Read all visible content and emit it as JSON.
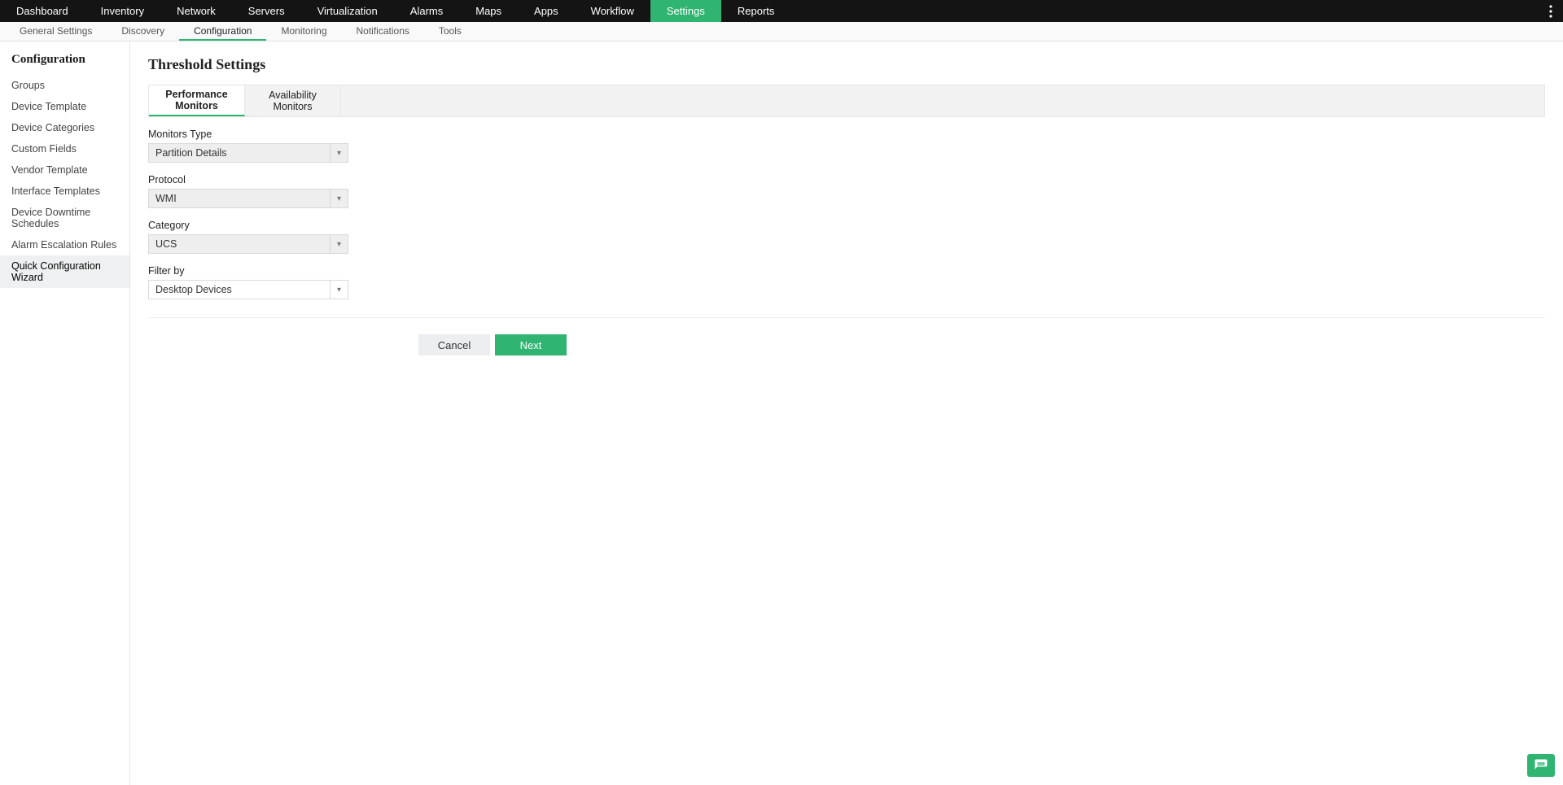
{
  "topnav": {
    "items": [
      "Dashboard",
      "Inventory",
      "Network",
      "Servers",
      "Virtualization",
      "Alarms",
      "Maps",
      "Apps",
      "Workflow",
      "Settings",
      "Reports"
    ],
    "active_index": 9
  },
  "subnav": {
    "items": [
      "General Settings",
      "Discovery",
      "Configuration",
      "Monitoring",
      "Notifications",
      "Tools"
    ],
    "active_index": 2
  },
  "sidebar": {
    "title": "Configuration",
    "items": [
      "Groups",
      "Device Template",
      "Device Categories",
      "Custom Fields",
      "Vendor Template",
      "Interface Templates",
      "Device Downtime Schedules",
      "Alarm Escalation Rules",
      "Quick Configuration Wizard"
    ],
    "active_index": 8
  },
  "page": {
    "title": "Threshold Settings"
  },
  "tabs": {
    "items": [
      {
        "line1": "Performance",
        "line2": "Monitors"
      },
      {
        "line1": "Availability",
        "line2": "Monitors"
      }
    ],
    "active_index": 0
  },
  "form": {
    "monitors_type": {
      "label": "Monitors Type",
      "value": "Partition Details"
    },
    "protocol": {
      "label": "Protocol",
      "value": "WMI"
    },
    "category": {
      "label": "Category",
      "value": "UCS"
    },
    "filter_by": {
      "label": "Filter by",
      "value": "Desktop Devices"
    }
  },
  "buttons": {
    "cancel": "Cancel",
    "next": "Next"
  },
  "icons": {
    "kebab": "kebab-menu-icon",
    "help": "help-chat-icon",
    "caret": "▾"
  }
}
